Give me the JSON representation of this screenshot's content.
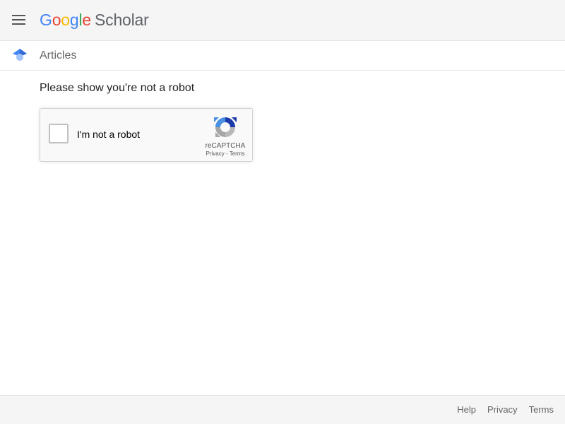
{
  "header": {
    "menu_icon": "hamburger-menu-icon",
    "logo": {
      "letters": [
        "G",
        "o",
        "o",
        "g",
        "l",
        "e"
      ],
      "product": "Scholar"
    }
  },
  "subbar": {
    "icon": "graduation-cap-icon",
    "title": "Articles"
  },
  "main": {
    "prompt": "Please show you're not a robot",
    "captcha": {
      "checkbox_label": "I'm not a robot",
      "brand": "reCAPTCHA",
      "privacy_link": "Privacy",
      "separator": " - ",
      "terms_link": "Terms",
      "checked": false
    }
  },
  "footer": {
    "links": [
      "Help",
      "Privacy",
      "Terms"
    ]
  },
  "colors": {
    "google_blue": "#4285f4",
    "google_red": "#ea4335",
    "google_yellow": "#fbbc05",
    "google_green": "#34a853"
  }
}
